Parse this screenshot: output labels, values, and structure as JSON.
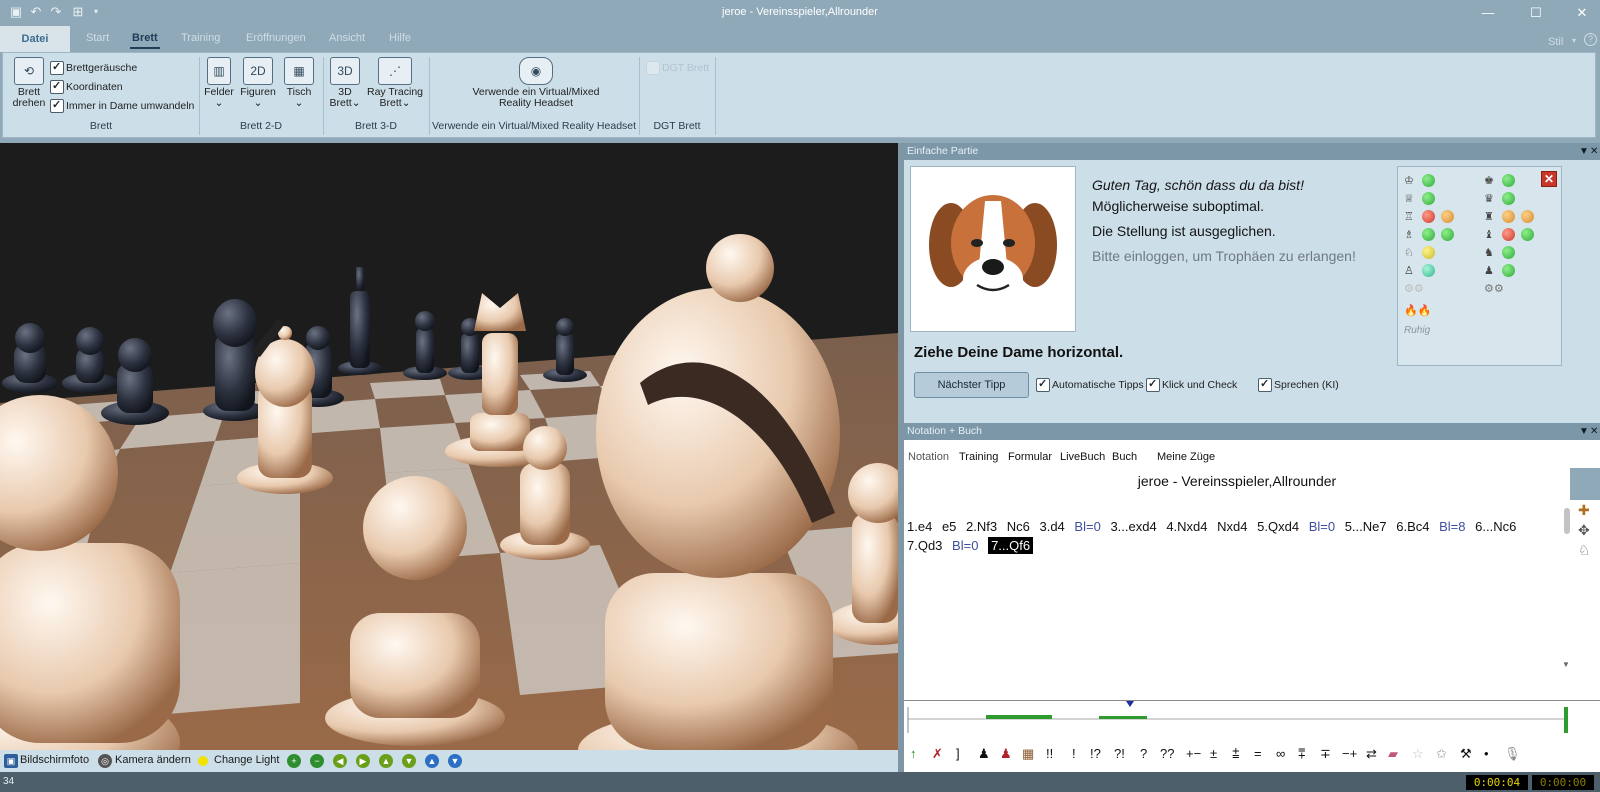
{
  "window": {
    "title": "jeroe - Vereinsspieler,Allrounder"
  },
  "ribbon_tabs": [
    {
      "label": "Datei"
    },
    {
      "label": "Start"
    },
    {
      "label": "Brett"
    },
    {
      "label": "Training"
    },
    {
      "label": "Eröffnungen"
    },
    {
      "label": "Ansicht"
    },
    {
      "label": "Hilfe"
    }
  ],
  "active_tab": "Brett",
  "style_menu": "Stil",
  "ribbon": {
    "brett": {
      "rotate_label_1": "Brett",
      "rotate_label_2": "drehen",
      "checks": [
        {
          "label": "Brettgeräusche",
          "checked": true
        },
        {
          "label": "Koordinaten",
          "checked": true
        },
        {
          "label": "Immer in Dame umwandeln",
          "checked": true
        }
      ],
      "group": "Brett"
    },
    "brett2d": {
      "felder": "Felder",
      "figuren": "Figuren",
      "tisch": "Tisch",
      "icon_2d": "2D",
      "group": "Brett 2-D"
    },
    "brett3d": {
      "b3d_1": "3D",
      "b3d_2": "Brett",
      "icon_3d": "3D",
      "ray_1": "Ray Tracing",
      "ray_2": "Brett",
      "group": "Brett 3-D"
    },
    "vr": {
      "label_1": "Verwende ein Virtual/Mixed",
      "label_2": "Reality Headset",
      "group": "Verwende ein Virtual/Mixed Reality Headset"
    },
    "dgt": {
      "check": "DGT Brett",
      "group": "DGT Brett"
    }
  },
  "board_toolbar": {
    "screenshot": "Bildschirmfoto",
    "camera": "Kamera ändern",
    "light": "Change Light"
  },
  "einfache_partie": {
    "header": "Einfache Partie",
    "greeting": "Guten Tag, schön dass du da bist!",
    "line2": "Möglicherweise suboptimal.",
    "line3": "Die Stellung ist ausgeglichen.",
    "login": "Bitte einloggen, um Trophäen zu erlangen!",
    "hint": "Ziehe Deine Dame horizontal.",
    "next_tip": "Nächster Tipp",
    "options": [
      {
        "label": "Automatische Tipps",
        "checked": true
      },
      {
        "label": "Klick und Check",
        "checked": true
      },
      {
        "label": "Sprechen (KI)",
        "checked": true
      }
    ],
    "trophy_status": "Ruhig",
    "colors": {
      "green": "#2fa83a",
      "red": "#cc3a2a",
      "orange": "#d48a2a",
      "yellow": "#c8b82a",
      "teal": "#32b58c"
    }
  },
  "notation": {
    "header": "Notation + Buch",
    "tabs": [
      "Notation",
      "Training",
      "Formular",
      "LiveBuch",
      "Buch",
      "Meine Züge"
    ],
    "game_title": "jeroe - Vereinsspieler,Allrounder",
    "moves": [
      {
        "t": "1.e4",
        "k": "m"
      },
      {
        "t": "e5",
        "k": "m"
      },
      {
        "t": "2.Nf3",
        "k": "m"
      },
      {
        "t": "Nc6",
        "k": "m"
      },
      {
        "t": "3.d4",
        "k": "m"
      },
      {
        "t": "Bl=0",
        "k": "ev"
      },
      {
        "t": "3...exd4",
        "k": "m"
      },
      {
        "t": "4.Nxd4",
        "k": "m"
      },
      {
        "t": "Nxd4",
        "k": "m"
      },
      {
        "t": "5.Qxd4",
        "k": "m"
      },
      {
        "t": "Bl=0",
        "k": "ev"
      },
      {
        "t": "5...Ne7",
        "k": "m"
      },
      {
        "t": "6.Bc4",
        "k": "m"
      },
      {
        "t": "Bl=8",
        "k": "ev"
      },
      {
        "t": "6...Nc6",
        "k": "m"
      },
      {
        "t": "7.Qd3",
        "k": "m"
      },
      {
        "t": "Bl=0",
        "k": "ev"
      },
      {
        "t": "7...Qf6",
        "k": "cur"
      }
    ]
  },
  "annotation_symbols": [
    "!!",
    "!",
    "!?",
    "?!",
    "?",
    "??",
    "+−",
    "±",
    "⩲",
    "=",
    "∞",
    "⩱",
    "∓",
    "−+",
    "⇄"
  ],
  "status": {
    "left": "34",
    "clock_white": "0:00:04",
    "clock_black": "0:00:00"
  }
}
